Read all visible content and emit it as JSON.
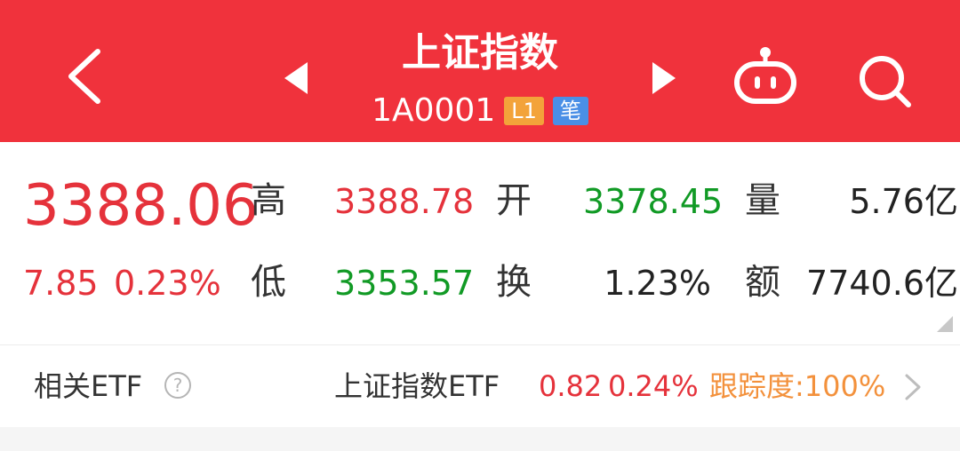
{
  "header": {
    "title": "上证指数",
    "code": "1A0001",
    "badges": [
      "L1",
      "笔"
    ],
    "bg_color": "#f0323c",
    "icons": {
      "back": "chevron-left-icon",
      "prev": "triangle-left-icon",
      "next": "triangle-right-icon",
      "robot": "robot-icon",
      "search": "search-icon"
    }
  },
  "quote": {
    "price": "3388.06",
    "change": "7.85",
    "change_pct": "0.23%",
    "fields": [
      {
        "label": "高",
        "value": "3388.78"
      },
      {
        "label": "开",
        "value": "3378.45"
      },
      {
        "label": "量",
        "value": "5.76亿"
      },
      {
        "label": "低",
        "value": "3353.57"
      },
      {
        "label": "换",
        "value": "1.23%"
      },
      {
        "label": "额",
        "value": "7740.6亿"
      }
    ],
    "colors": {
      "up": "#e5323b",
      "down": "#119a25"
    }
  },
  "etf": {
    "label": "相关ETF",
    "help_glyph": "?",
    "name": "上证指数ETF",
    "price": "0.82",
    "pct": "0.24%",
    "tracking": "跟踪度:100%"
  }
}
